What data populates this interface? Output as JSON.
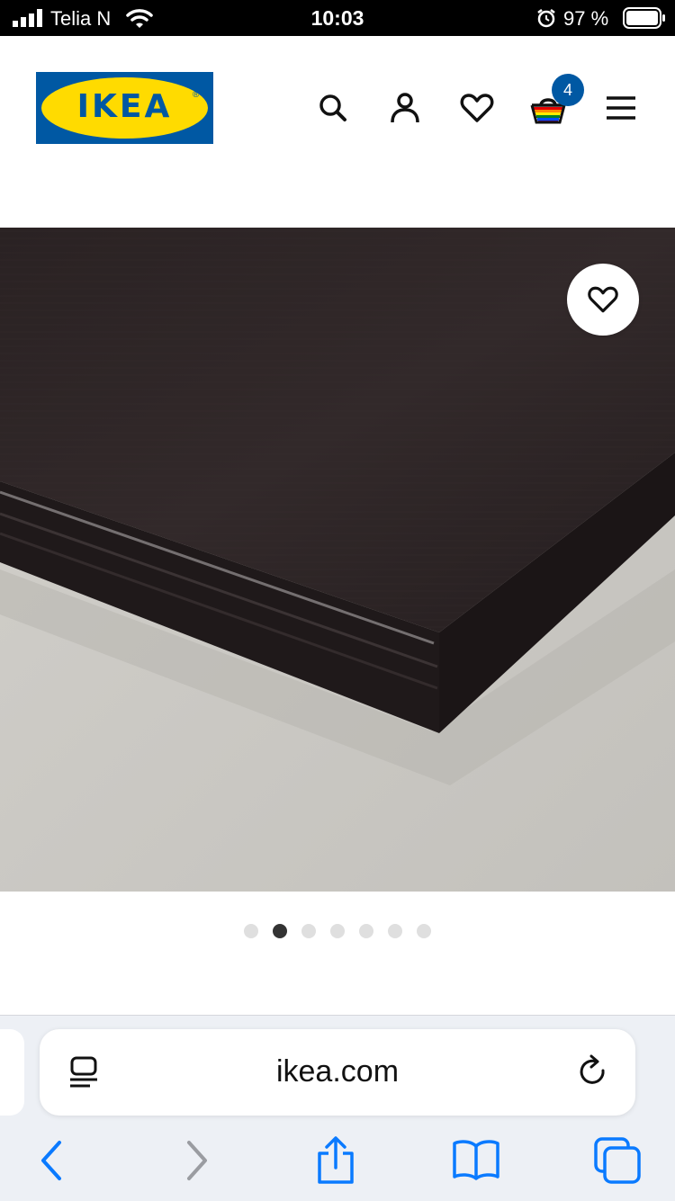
{
  "status_bar": {
    "carrier": "Telia N",
    "time": "10:03",
    "battery": "97 %"
  },
  "header": {
    "logo_text": "IKEA",
    "logo_reg": "®",
    "cart_count": "4",
    "icons": [
      "search-icon",
      "account-icon",
      "heart-icon",
      "basket-icon",
      "menu-icon"
    ]
  },
  "gallery": {
    "page_count": 7,
    "active_page": 2,
    "favourite_icon": "heart-icon"
  },
  "browser": {
    "url": "ikea.com",
    "icons": [
      "reader-icon",
      "reload-icon",
      "back-icon",
      "forward-icon",
      "share-icon",
      "bookmarks-icon",
      "tabs-icon"
    ]
  },
  "colors": {
    "ikea_blue": "#0058a3",
    "ikea_yellow": "#ffdb00",
    "safari_blue": "#0a7aff"
  }
}
